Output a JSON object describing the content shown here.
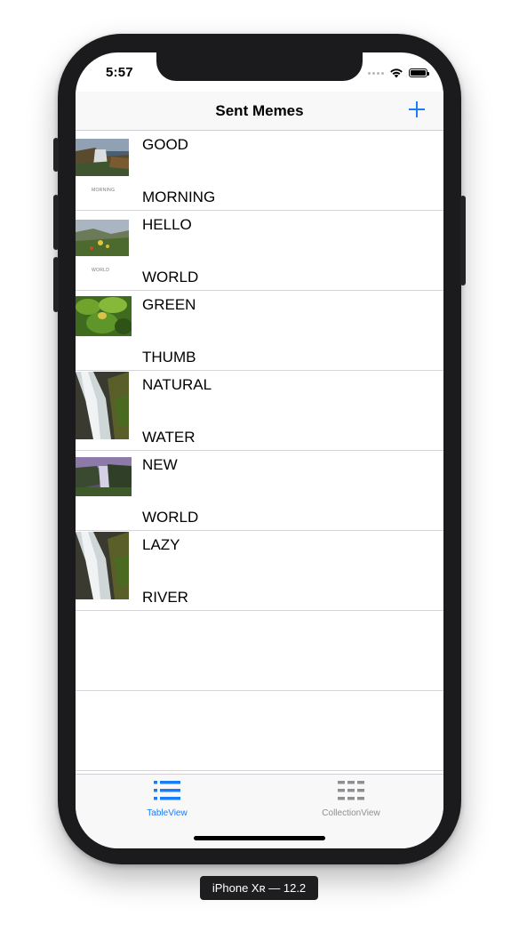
{
  "status_bar": {
    "time": "5:57"
  },
  "nav": {
    "title": "Sent Memes",
    "add_icon": "plus-icon"
  },
  "colors": {
    "accent": "#1a7cf6",
    "inactive": "#8e8e93"
  },
  "memes": [
    {
      "top": "GOOD",
      "bottom": "MORNING",
      "image": "waterfall-cliff"
    },
    {
      "top": "HELLO",
      "bottom": "WORLD",
      "image": "meadow-flowers"
    },
    {
      "top": "GREEN",
      "bottom": "THUMB",
      "image": "green-leaves"
    },
    {
      "top": "NATURAL",
      "bottom": "WATER",
      "image": "cascade-rocks"
    },
    {
      "top": "NEW",
      "bottom": "WORLD",
      "image": "waterfall-valley"
    },
    {
      "top": "LAZY",
      "bottom": "RIVER",
      "image": "cascade-rocks"
    }
  ],
  "tabs": [
    {
      "label": "TableView",
      "icon": "list-icon",
      "active": true
    },
    {
      "label": "CollectionView",
      "icon": "grid-icon",
      "active": false
    }
  ],
  "device_caption": "iPhone Xʀ — 12.2"
}
